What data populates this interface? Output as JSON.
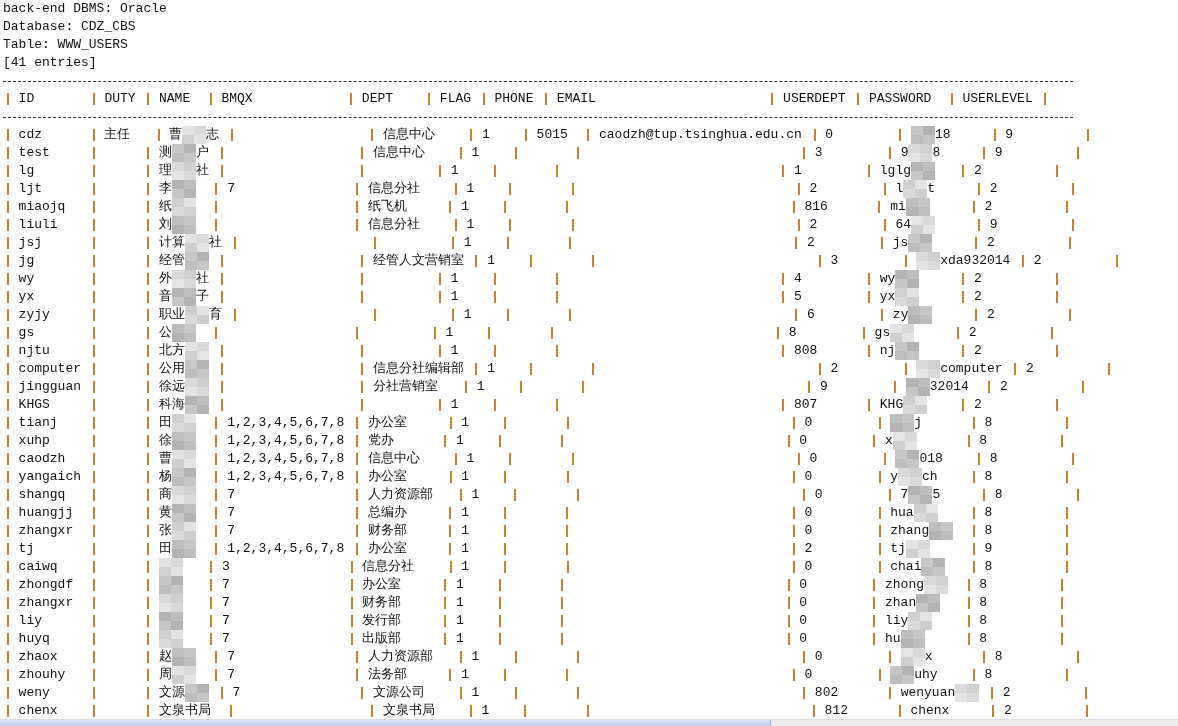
{
  "info_lines": [
    "back-end DBMS: Oracle",
    "Database: CDZ_CBS",
    "Table: WWW_USERS",
    "[41 entries]"
  ],
  "table": {
    "columns": [
      "ID",
      "DUTY",
      "NAME",
      "BMQX",
      "DEPT",
      "FLAG",
      "PHONE",
      "EMAIL",
      "USERDEPT",
      "PASSWORD",
      "USERLEVEL"
    ],
    "rows": [
      {
        "cells": [
          "cdz",
          "主任",
          {
            "kind": "masked",
            "start": "曹",
            "end": "志"
          },
          null,
          "信息中心",
          "1",
          "5015",
          "caodzh@tup.tsinghua.edu.cn",
          "0",
          {
            "kind": "masked",
            "end": "18"
          },
          "9"
        ]
      },
      {
        "cells": [
          "test",
          null,
          {
            "kind": "masked",
            "start": "测",
            "end": "户"
          },
          null,
          "信息中心",
          "1",
          null,
          null,
          "3",
          {
            "kind": "masked",
            "start": "9",
            "end": "8"
          },
          "9"
        ]
      },
      {
        "cells": [
          "lg",
          null,
          {
            "kind": "masked",
            "start": "理",
            "end": "社"
          },
          null,
          null,
          "1",
          null,
          null,
          "1",
          {
            "kind": "masked",
            "start": "lglg"
          },
          "2"
        ]
      },
      {
        "cells": [
          "ljt",
          null,
          {
            "kind": "masked",
            "start": "李"
          },
          "7",
          "信息分社",
          "1",
          null,
          null,
          "2",
          {
            "kind": "masked",
            "start": "l",
            "end": "t"
          },
          "2"
        ]
      },
      {
        "cells": [
          "miaojq",
          null,
          {
            "kind": "masked",
            "start": "纸"
          },
          null,
          "纸飞机",
          "1",
          null,
          null,
          "816",
          {
            "kind": "masked",
            "start": "mi"
          },
          "2"
        ]
      },
      {
        "cells": [
          "liuli",
          null,
          {
            "kind": "masked",
            "start": "刘"
          },
          null,
          "信息分社",
          "1",
          null,
          null,
          "2",
          {
            "kind": "masked",
            "start": "64"
          },
          "9"
        ]
      },
      {
        "cells": [
          "jsj",
          null,
          {
            "kind": "masked",
            "start": "计算",
            "end": "社"
          },
          null,
          null,
          "1",
          null,
          null,
          "2",
          {
            "kind": "masked",
            "start": "js"
          },
          "2"
        ]
      },
      {
        "cells": [
          "jg",
          null,
          {
            "kind": "masked",
            "start": "经管"
          },
          null,
          "经管人文营销室",
          "1",
          null,
          null,
          "3",
          {
            "kind": "masked",
            "end": "xda932014"
          },
          "2"
        ]
      },
      {
        "cells": [
          "wy",
          null,
          {
            "kind": "masked",
            "start": "外",
            "end": "社"
          },
          null,
          null,
          "1",
          null,
          null,
          "4",
          {
            "kind": "masked",
            "start": "wy"
          },
          "2"
        ]
      },
      {
        "cells": [
          "yx",
          null,
          {
            "kind": "masked",
            "start": "音",
            "end": "子"
          },
          null,
          null,
          "1",
          null,
          null,
          "5",
          {
            "kind": "masked",
            "start": "yx"
          },
          "2"
        ]
      },
      {
        "cells": [
          "zyjy",
          null,
          {
            "kind": "masked",
            "start": "职业",
            "end": "育"
          },
          null,
          null,
          "1",
          null,
          null,
          "6",
          {
            "kind": "masked",
            "start": "zy"
          },
          "2"
        ]
      },
      {
        "cells": [
          "gs",
          null,
          {
            "kind": "masked",
            "start": "公"
          },
          null,
          null,
          "1",
          null,
          null,
          "8",
          {
            "kind": "masked",
            "start": "gs"
          },
          "2"
        ]
      },
      {
        "cells": [
          "njtu",
          null,
          {
            "kind": "masked",
            "start": "北方"
          },
          null,
          null,
          "1",
          null,
          null,
          "808",
          {
            "kind": "masked",
            "start": "nj"
          },
          "2"
        ]
      },
      {
        "cells": [
          "computer",
          null,
          {
            "kind": "masked",
            "start": "公用"
          },
          null,
          "信息分社编辑部",
          "1",
          null,
          null,
          "2",
          {
            "kind": "masked",
            "end": "computer"
          },
          "2"
        ]
      },
      {
        "cells": [
          "jingguan",
          null,
          {
            "kind": "masked",
            "start": "徐远"
          },
          null,
          "分社营销室",
          "1",
          null,
          null,
          "9",
          {
            "kind": "masked",
            "end": "32014"
          },
          "2"
        ]
      },
      {
        "cells": [
          "KHGS",
          null,
          {
            "kind": "masked",
            "start": "科海"
          },
          null,
          null,
          "1",
          null,
          null,
          "807",
          {
            "kind": "masked",
            "start": "KHG"
          },
          "2"
        ]
      },
      {
        "cells": [
          "tianj",
          null,
          {
            "kind": "masked",
            "start": "田"
          },
          "1,2,3,4,5,6,7,8",
          "办公室",
          "1",
          null,
          null,
          "0",
          {
            "kind": "masked",
            "end": "j"
          },
          "8"
        ]
      },
      {
        "cells": [
          "xuhp",
          null,
          {
            "kind": "masked",
            "start": "徐"
          },
          "1,2,3,4,5,6,7,8",
          "党办",
          "1",
          null,
          null,
          "0",
          {
            "kind": "masked",
            "start": "x"
          },
          "8"
        ]
      },
      {
        "cells": [
          "caodzh",
          null,
          {
            "kind": "masked",
            "start": "曹"
          },
          "1,2,3,4,5,6,7,8",
          "信息中心",
          "1",
          null,
          null,
          "0",
          {
            "kind": "masked",
            "end": "018"
          },
          "8"
        ]
      },
      {
        "cells": [
          "yangaich",
          null,
          {
            "kind": "masked",
            "start": "杨"
          },
          "1,2,3,4,5,6,7,8",
          "办公室",
          "1",
          null,
          null,
          "0",
          {
            "kind": "masked",
            "start": "y",
            "end": "ch"
          },
          "8"
        ]
      },
      {
        "cells": [
          "shangq",
          null,
          {
            "kind": "masked",
            "start": "商"
          },
          "7",
          "人力资源部",
          "1",
          null,
          null,
          "0",
          {
            "kind": "masked",
            "start": "7",
            "end": "5"
          },
          "8"
        ]
      },
      {
        "cells": [
          "huangjj",
          null,
          {
            "kind": "masked",
            "start": "黄"
          },
          "7",
          "总编办",
          "1",
          null,
          null,
          "0",
          {
            "kind": "masked",
            "start": "hua"
          },
          "8"
        ]
      },
      {
        "cells": [
          "zhangxr",
          null,
          {
            "kind": "masked",
            "start": "张"
          },
          "7",
          "财务部",
          "1",
          null,
          null,
          "0",
          {
            "kind": "masked",
            "start": "zhang"
          },
          "8"
        ]
      },
      {
        "cells": [
          "tj",
          null,
          {
            "kind": "masked",
            "start": "田"
          },
          "1,2,3,4,5,6,7,8",
          "办公室",
          "1",
          null,
          null,
          "2",
          {
            "kind": "masked",
            "start": "tj"
          },
          "9"
        ]
      },
      {
        "cells": [
          "caiwq",
          null,
          {
            "kind": "masked"
          },
          "3",
          "信息分社",
          "1",
          null,
          null,
          "0",
          {
            "kind": "masked",
            "start": "chai"
          },
          "8"
        ]
      },
      {
        "cells": [
          "zhongdf",
          null,
          {
            "kind": "masked"
          },
          "7",
          "办公室",
          "1",
          null,
          null,
          "0",
          {
            "kind": "masked",
            "start": "zhong"
          },
          "8"
        ]
      },
      {
        "cells": [
          "zhangxr",
          null,
          {
            "kind": "masked"
          },
          "7",
          "财务部",
          "1",
          null,
          null,
          "0",
          {
            "kind": "masked",
            "start": "zhan"
          },
          "8"
        ]
      },
      {
        "cells": [
          "liy",
          null,
          {
            "kind": "masked"
          },
          "7",
          "发行部",
          "1",
          null,
          null,
          "0",
          {
            "kind": "masked",
            "start": "liy"
          },
          "8"
        ]
      },
      {
        "cells": [
          "huyq",
          null,
          {
            "kind": "masked"
          },
          "7",
          "出版部",
          "1",
          null,
          null,
          "0",
          {
            "kind": "masked",
            "start": "hu"
          },
          "8"
        ]
      },
      {
        "cells": [
          "zhaox",
          null,
          {
            "kind": "masked",
            "start": "赵"
          },
          "7",
          "人力资源部",
          "1",
          null,
          null,
          "0",
          {
            "kind": "masked",
            "end": "x"
          },
          "8"
        ]
      },
      {
        "cells": [
          "zhouhy",
          null,
          {
            "kind": "masked",
            "start": "周"
          },
          "7",
          "法务部",
          "1",
          null,
          null,
          "0",
          {
            "kind": "masked",
            "end": "uhy"
          },
          "8"
        ]
      },
      {
        "cells": [
          "weny",
          null,
          {
            "kind": "masked",
            "start": "文源"
          },
          "7",
          "文源公司",
          "1",
          null,
          null,
          "802",
          {
            "kind": "masked",
            "start": "wenyuan"
          },
          "2"
        ]
      },
      {
        "cells": [
          "chenx",
          null,
          "文泉书局",
          null,
          "文泉书局",
          "1",
          null,
          null,
          "812",
          "chenx",
          "2"
        ]
      }
    ]
  }
}
